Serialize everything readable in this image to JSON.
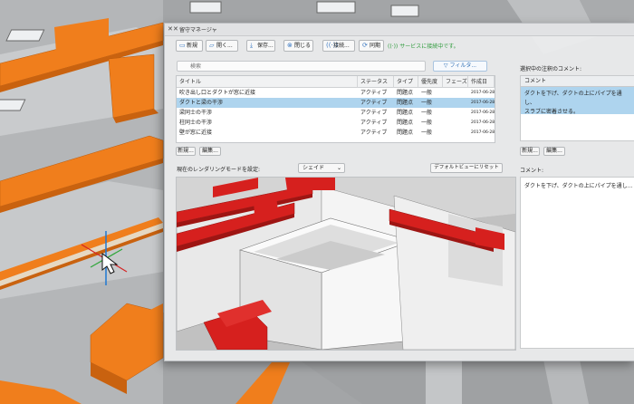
{
  "window": {
    "title": "留守マネージャ",
    "close_glyph": "✕",
    "min_glyph": "✕"
  },
  "toolbar": {
    "new_label": "新規",
    "open_label": "開く...",
    "save_label": "保存...",
    "close_label": "閉じる",
    "connect_label": "接続...",
    "sync_label": "同期",
    "status_text": "サービスに接続中です。"
  },
  "search": {
    "placeholder": "検索"
  },
  "filter": {
    "label": "フィルタ..."
  },
  "table": {
    "columns": [
      "タイトル",
      "ステータス",
      "タイプ",
      "優先度",
      "フェーズ",
      "作成日"
    ],
    "rows": [
      {
        "title": "吹き出し口とダクトが窓に近接",
        "status": "アクティブ",
        "type": "問題点",
        "priority": "一般",
        "phase": "",
        "date": "2017-06-28"
      },
      {
        "title": "ダクトと梁の干渉",
        "status": "アクティブ",
        "type": "問題点",
        "priority": "一般",
        "phase": "",
        "date": "2017-06-28"
      },
      {
        "title": "梁同士の干渉",
        "status": "アクティブ",
        "type": "問題点",
        "priority": "一般",
        "phase": "",
        "date": "2017-06-28"
      },
      {
        "title": "柱同士の干渉",
        "status": "アクティブ",
        "type": "問題点",
        "priority": "一般",
        "phase": "",
        "date": "2017-06-28"
      },
      {
        "title": "壁が窓に近接",
        "status": "アクティブ",
        "type": "問題点",
        "priority": "一般",
        "phase": "",
        "date": "2017-06-28"
      }
    ],
    "selected_index": 1
  },
  "issue_buttons": {
    "new_label": "新規...",
    "edit_label": "編集..."
  },
  "render": {
    "mode_label": "現在のレンダリングモードを設定:",
    "mode_value": "シェイド",
    "reset_label": "デフォルトビューにリセット"
  },
  "comments": {
    "heading": "選択中の注釈のコメント:",
    "column": "コメント",
    "selected_text_line1": "ダクトを下げ、ダクトの上にパイプを通し、",
    "selected_text_line2": "スラブに密着させる。",
    "new_label": "新規...",
    "edit_label": "編集...",
    "comment_label": "コメント:",
    "comment_text": "ダクトを下げ、ダクトの上にパイプを通し..."
  },
  "colors": {
    "duct_orange": "#f07e1c",
    "clash_red": "#d6201e",
    "selection_blue": "#aed4ee",
    "status_green": "#2e9b3c",
    "accent_blue": "#3a78c2"
  }
}
